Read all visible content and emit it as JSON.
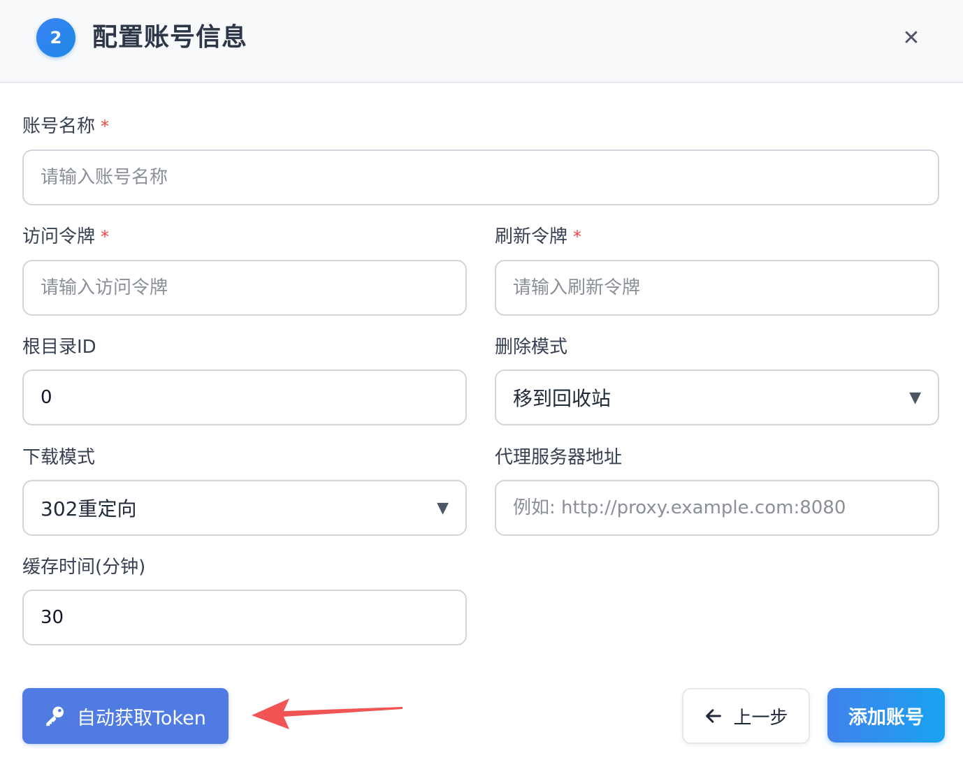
{
  "header": {
    "step_number": "2",
    "title": "配置账号信息",
    "close_glyph": "✕"
  },
  "form": {
    "account_name": {
      "label": "账号名称",
      "required_mark": "*",
      "placeholder": "请输入账号名称",
      "value": ""
    },
    "access_token": {
      "label": "访问令牌",
      "required_mark": "*",
      "placeholder": "请输入访问令牌",
      "value": ""
    },
    "refresh_token": {
      "label": "刷新令牌",
      "required_mark": "*",
      "placeholder": "请输入刷新令牌",
      "value": ""
    },
    "root_dir_id": {
      "label": "根目录ID",
      "value": "0"
    },
    "delete_mode": {
      "label": "删除模式",
      "selected": "移到回收站"
    },
    "download_mode": {
      "label": "下载模式",
      "selected": "302重定向"
    },
    "proxy_address": {
      "label": "代理服务器地址",
      "placeholder": "例如: http://proxy.example.com:8080",
      "value": ""
    },
    "cache_time": {
      "label": "缓存时间(分钟)",
      "value": "30"
    }
  },
  "actions": {
    "auto_token_label": "自动获取Token",
    "back_label": "上一步",
    "add_label": "添加账号"
  },
  "icons": {
    "close": "close-icon",
    "key": "key-icon",
    "back": "arrow-left-icon",
    "caret": "chevron-down-icon",
    "annotation": "red-arrow-icon"
  },
  "colors": {
    "primary": "#4f7be3",
    "accent_gradient_start": "#3f82ec",
    "accent_gradient_end": "#1aa3f0",
    "required": "#ef4444",
    "annotation_arrow": "#f05454"
  }
}
